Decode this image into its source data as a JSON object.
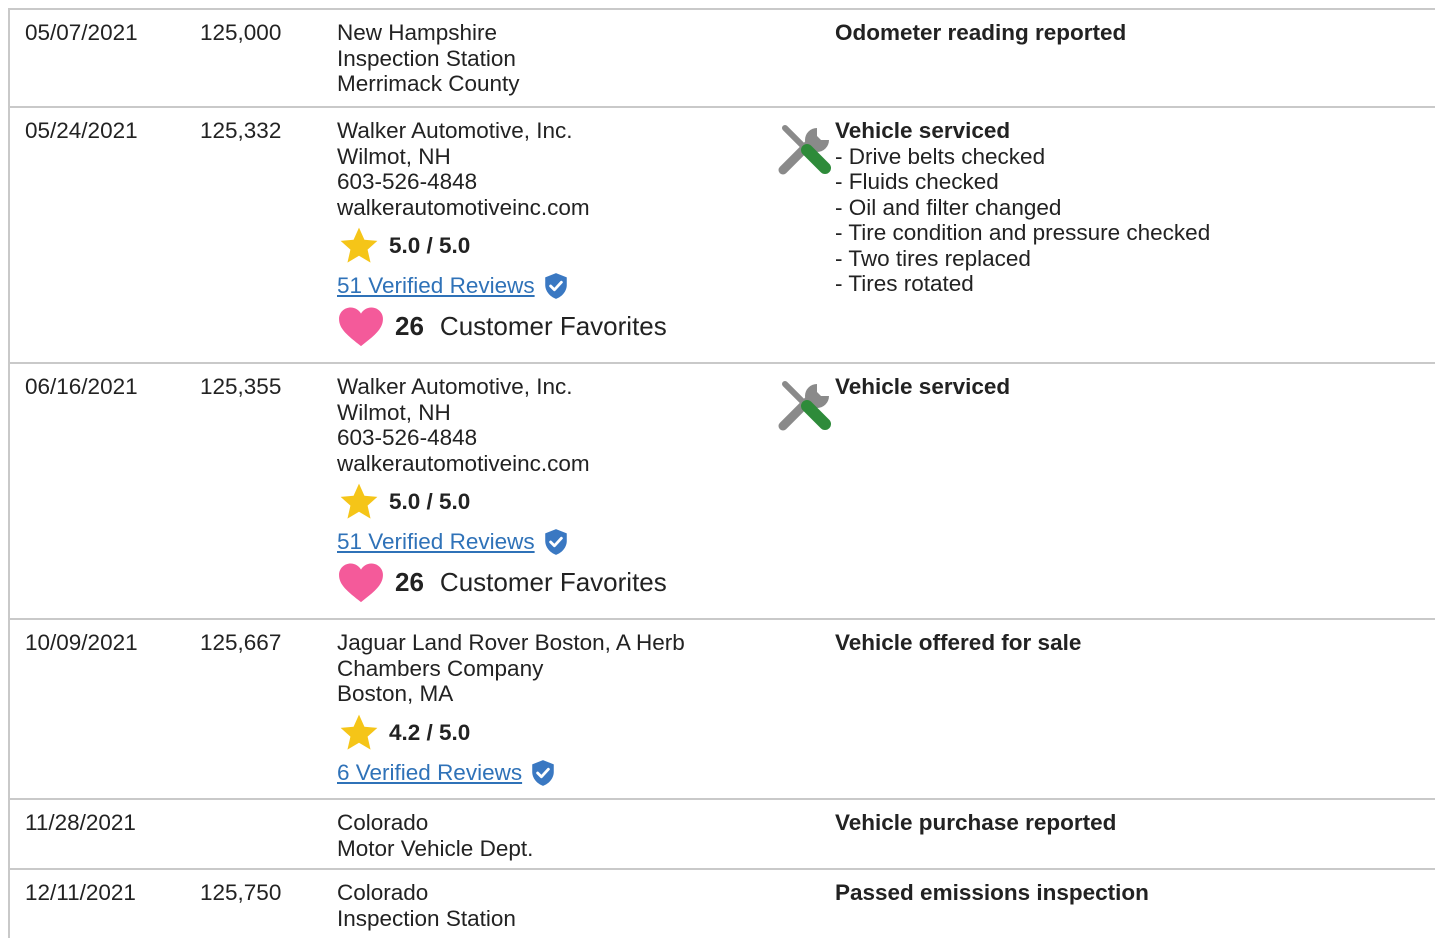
{
  "rows": [
    {
      "date": "05/07/2021",
      "odometer": "125,000",
      "source": [
        "New Hampshire",
        "Inspection Station",
        "Merrimack County"
      ],
      "event": "Odometer reading reported",
      "details": []
    },
    {
      "date": "05/24/2021",
      "odometer": "125,332",
      "source": [
        "Walker Automotive, Inc.",
        "Wilmot, NH",
        "603-526-4848",
        "walkerautomotiveinc.com"
      ],
      "rating": "5.0 / 5.0",
      "reviews": "51 Verified Reviews",
      "favorites_count": "26",
      "favorites_label": "Customer Favorites",
      "event_icon": "service-tools-icon",
      "event": "Vehicle serviced",
      "details": [
        "- Drive belts checked",
        "- Fluids checked",
        "- Oil and filter changed",
        "- Tire condition and pressure checked",
        "- Two tires replaced",
        "- Tires rotated"
      ]
    },
    {
      "date": "06/16/2021",
      "odometer": "125,355",
      "source": [
        "Walker Automotive, Inc.",
        "Wilmot, NH",
        "603-526-4848",
        "walkerautomotiveinc.com"
      ],
      "rating": "5.0 / 5.0",
      "reviews": "51 Verified Reviews",
      "favorites_count": "26",
      "favorites_label": "Customer Favorites",
      "event_icon": "service-tools-icon",
      "event": "Vehicle serviced",
      "details": []
    },
    {
      "date": "10/09/2021",
      "odometer": "125,667",
      "source": [
        "Jaguar Land Rover Boston, A Herb",
        "Chambers Company",
        "Boston, MA"
      ],
      "rating": "4.2 / 5.0",
      "reviews": "6 Verified Reviews",
      "event": "Vehicle offered for sale",
      "details": []
    },
    {
      "date": "11/28/2021",
      "odometer": "",
      "source": [
        "Colorado",
        "Motor Vehicle Dept."
      ],
      "event": "Vehicle purchase reported",
      "details": []
    },
    {
      "date": "12/11/2021",
      "odometer": "125,750",
      "source": [
        "Colorado",
        "Inspection Station"
      ],
      "event": "Passed emissions inspection",
      "details": []
    }
  ],
  "colors": {
    "border": "#c9c9c9",
    "link": "#2f72b8",
    "star": "#f5c518",
    "heart": "#f45a9a",
    "shield": "#3a78c2",
    "tool_gray": "#8a8a8a",
    "tool_green": "#2e8b3a"
  }
}
